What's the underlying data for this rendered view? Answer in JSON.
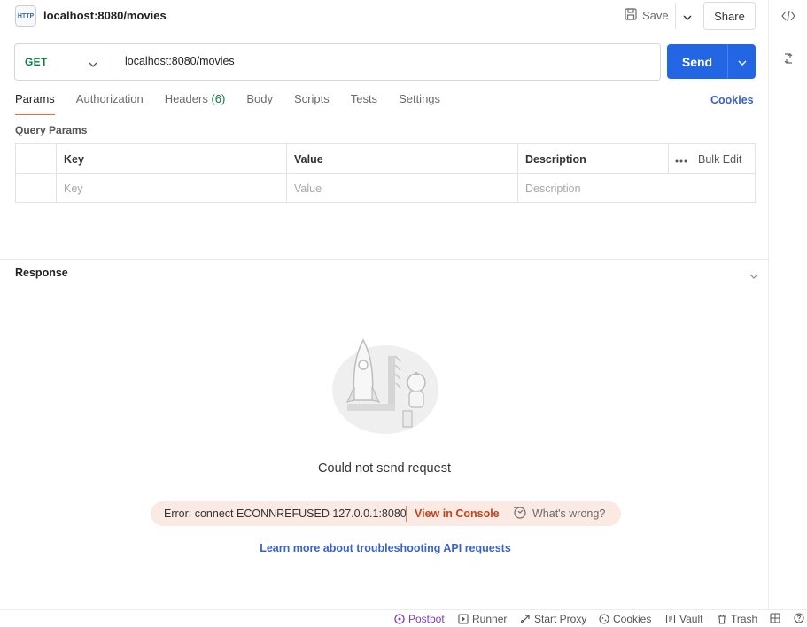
{
  "header": {
    "icon_text": "HTTP",
    "title": "localhost:8080/movies",
    "save_label": "Save",
    "share_label": "Share"
  },
  "request": {
    "method": "GET",
    "url": "localhost:8080/movies",
    "send_label": "Send"
  },
  "tabs": [
    {
      "label": "Params",
      "active": true
    },
    {
      "label": "Authorization"
    },
    {
      "label": "Headers",
      "count": "(6)"
    },
    {
      "label": "Body"
    },
    {
      "label": "Scripts"
    },
    {
      "label": "Tests"
    },
    {
      "label": "Settings"
    }
  ],
  "cookies_link": "Cookies",
  "query_params": {
    "title": "Query Params",
    "columns": [
      "Key",
      "Value",
      "Description"
    ],
    "bulk_edit": "Bulk Edit",
    "placeholders": [
      "Key",
      "Value",
      "Description"
    ]
  },
  "response": {
    "title": "Response",
    "error_title": "Could not send request",
    "error_message": "Error: connect ECONNREFUSED 127.0.0.1:8080",
    "view_console": "View in Console",
    "whats_wrong": "What's wrong?",
    "learn_link": "Learn more about troubleshooting API requests"
  },
  "statusbar": [
    {
      "label": "Postbot",
      "icon": "postbot-icon"
    },
    {
      "label": "Runner",
      "icon": "runner-icon"
    },
    {
      "label": "Start Proxy",
      "icon": "proxy-icon"
    },
    {
      "label": "Cookies",
      "icon": "cookie-icon"
    },
    {
      "label": "Vault",
      "icon": "vault-icon"
    },
    {
      "label": "Trash",
      "icon": "trash-icon"
    }
  ],
  "colors": {
    "accent": "#2266e3",
    "method_get": "#0b7a3e",
    "tab_underline": "#f26b3a",
    "error_bg": "#fbe9e3",
    "error_link": "#c2451e",
    "link": "#3a62c9"
  }
}
